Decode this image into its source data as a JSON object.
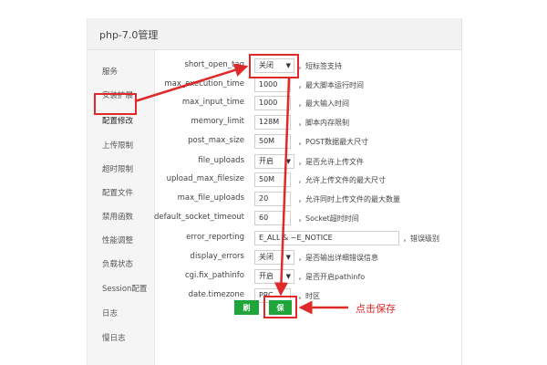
{
  "window": {
    "title": "php-7.0管理"
  },
  "sidebar": {
    "items": [
      {
        "label": "服务"
      },
      {
        "label": "安装扩展"
      },
      {
        "label": "配置修改"
      },
      {
        "label": "上传限制"
      },
      {
        "label": "超时限制"
      },
      {
        "label": "配置文件"
      },
      {
        "label": "禁用函数"
      },
      {
        "label": "性能调整"
      },
      {
        "label": "负载状态"
      },
      {
        "label": "Session配置"
      },
      {
        "label": "日志"
      },
      {
        "label": "慢日志"
      }
    ],
    "active_index": 2
  },
  "settings": [
    {
      "name": "short_open_tag",
      "kind": "select",
      "value": "关闭",
      "desc": "，短标签支持"
    },
    {
      "name": "max_execution_time",
      "kind": "input",
      "value": "1000",
      "desc": "，最大脚本运行时间"
    },
    {
      "name": "max_input_time",
      "kind": "input",
      "value": "1000",
      "desc": "，最大输入时间"
    },
    {
      "name": "memory_limit",
      "kind": "input",
      "value": "128M",
      "desc": "，脚本内存限制"
    },
    {
      "name": "post_max_size",
      "kind": "input",
      "value": "50M",
      "desc": "，POST数据最大尺寸"
    },
    {
      "name": "file_uploads",
      "kind": "select",
      "value": "开启",
      "desc": "，是否允许上传文件"
    },
    {
      "name": "upload_max_filesize",
      "kind": "input",
      "value": "50M",
      "desc": "，允许上传文件的最大尺寸"
    },
    {
      "name": "max_file_uploads",
      "kind": "input",
      "value": "20",
      "desc": "，允许同时上传文件的最大数量"
    },
    {
      "name": "default_socket_timeout",
      "kind": "input",
      "value": "60",
      "desc": "，Socket超时时间"
    },
    {
      "name": "error_reporting",
      "kind": "wide",
      "value": "E_ALL & ~E_NOTICE",
      "desc": "，错误级别"
    },
    {
      "name": "display_errors",
      "kind": "select",
      "value": "关闭",
      "desc": "，是否输出详细错误信息"
    },
    {
      "name": "cgi.fix_pathinfo",
      "kind": "select",
      "value": "开启",
      "desc": "，是否开启pathinfo"
    },
    {
      "name": "date.timezone",
      "kind": "input",
      "value": "PRC",
      "desc": "，时区"
    }
  ],
  "buttons": {
    "refresh": "刷新",
    "save": "保存"
  },
  "annotation": {
    "text": "点击保存",
    "color": "#e02a2a"
  },
  "colors": {
    "accent": "#20a53a",
    "highlight": "#e02a2a"
  },
  "icons": {
    "caret": "caret-down-icon"
  }
}
